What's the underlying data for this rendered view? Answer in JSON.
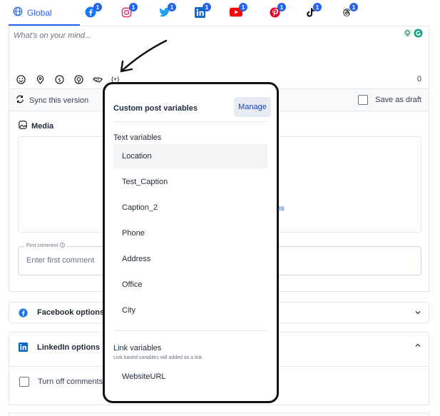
{
  "tabs": {
    "global_label": "Global",
    "social": [
      {
        "name": "facebook",
        "badge": "1",
        "color": "#1877f2"
      },
      {
        "name": "instagram",
        "badge": "1",
        "color": "#e1306c"
      },
      {
        "name": "twitter",
        "badge": "1",
        "color": "#1da1f2"
      },
      {
        "name": "linkedin",
        "badge": "1",
        "color": "#0a66c2"
      },
      {
        "name": "youtube",
        "badge": "1",
        "color": "#ff0000"
      },
      {
        "name": "pinterest",
        "badge": "1",
        "color": "#e60023"
      },
      {
        "name": "tiktok",
        "badge": "1",
        "color": "#000000"
      },
      {
        "name": "threads",
        "badge": "1",
        "color": "#000000"
      }
    ]
  },
  "composer": {
    "placeholder": "What's on your mind...",
    "char_count": "0",
    "variable_button": "{+}"
  },
  "syncbar": {
    "sync_label": "Sync this version",
    "draft_label": "Save as draft"
  },
  "media": {
    "title": "Media",
    "dropzone_link_fragment": "ns",
    "first_comment_legend": "First comment",
    "first_comment_placeholder": "Enter first comment"
  },
  "options": {
    "facebook_label": "Facebook options",
    "linkedin_label": "LinkedIn options",
    "turn_off_label": "Turn off comments"
  },
  "popover": {
    "title": "Custom post variables",
    "manage_label": "Manage",
    "text_section": "Text variables",
    "text_items": [
      "Location",
      "Test_Caption",
      "Caption_2",
      "Phone",
      "Address",
      "Office",
      "City"
    ],
    "link_section": "Link variables",
    "link_subtitle": "Link based variables will added as a link",
    "link_items": [
      "WebsiteURL"
    ]
  },
  "colors": {
    "accent": "#2563eb",
    "border": "#e5e7eb"
  }
}
